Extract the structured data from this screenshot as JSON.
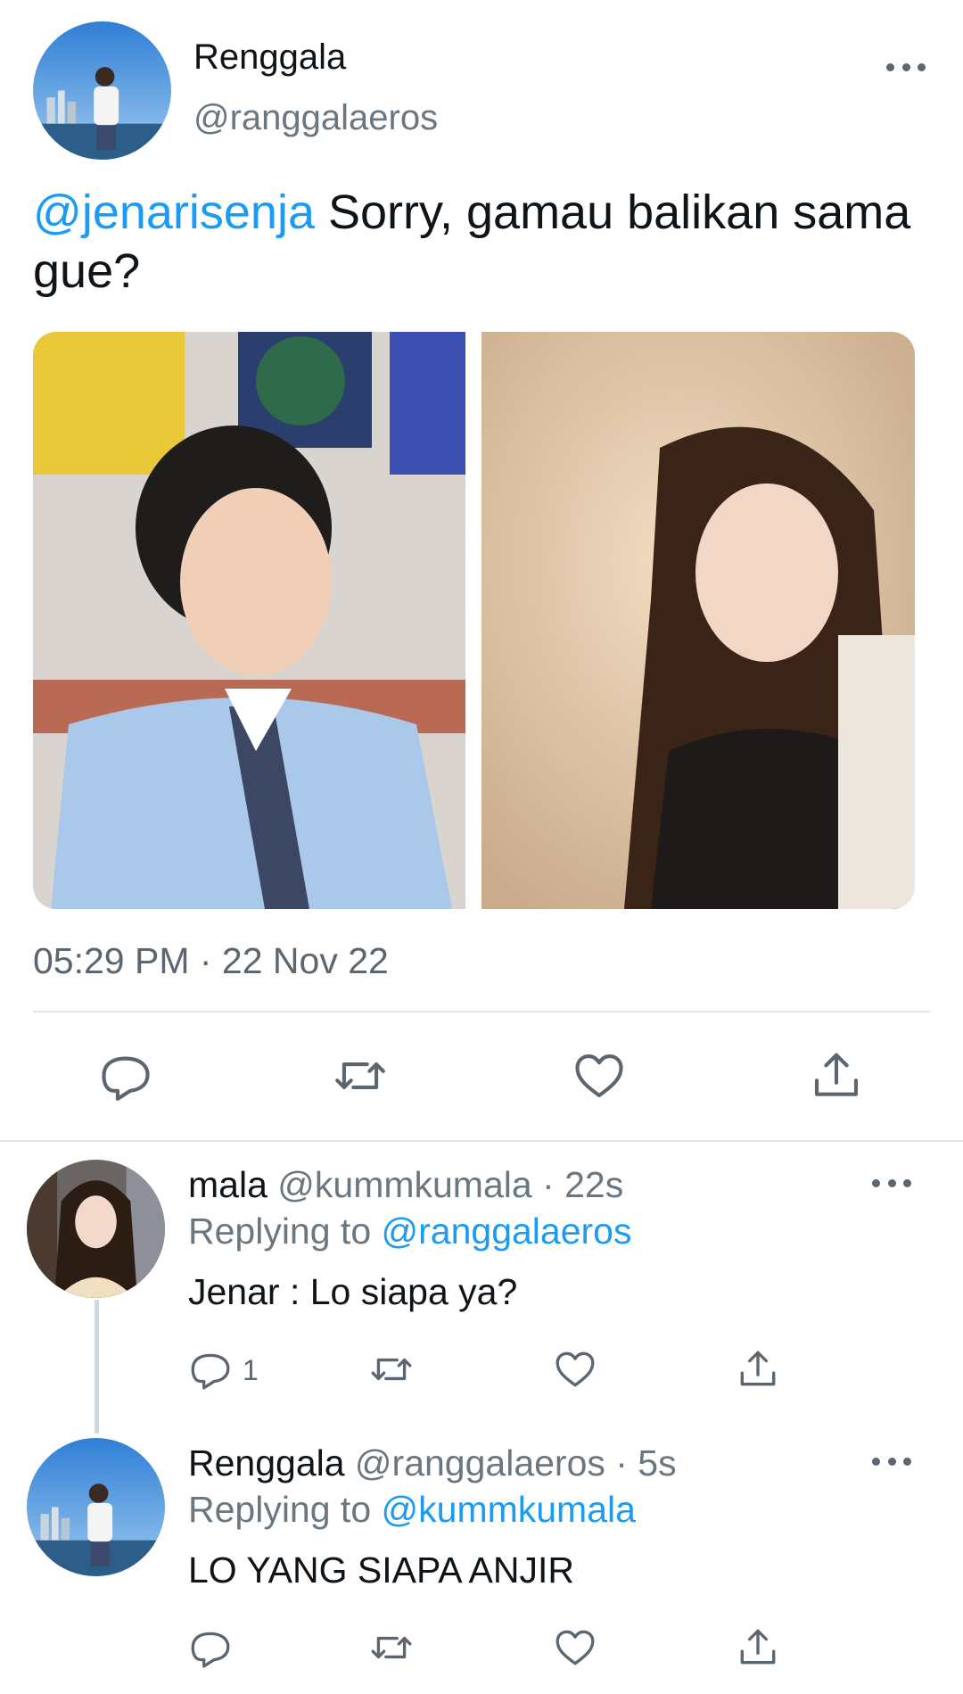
{
  "main_tweet": {
    "author_name": "Renggala",
    "author_handle": "@ranggalaeros",
    "mention": "@jenarisenja",
    "text": " Sorry, gamau balikan sama gue?",
    "timestamp": "05:29 PM · 22 Nov 22",
    "media": [
      "man-photo",
      "woman-photo"
    ]
  },
  "replies": [
    {
      "name": "mala",
      "handle_time": " @kummkumala · 22s",
      "replying_label": "Replying to ",
      "replying_to": "@ranggalaeros",
      "text": "Jenar : Lo siapa ya?",
      "reply_count": "1"
    },
    {
      "name": "Renggala",
      "handle_time": " @ranggalaeros · 5s",
      "replying_label": "Replying to ",
      "replying_to": "@kummkumala",
      "text": "LO YANG SIAPA ANJIR",
      "reply_count": ""
    }
  ],
  "icons": [
    "reply-icon",
    "retweet-icon",
    "like-icon",
    "share-icon",
    "more-icon"
  ],
  "colors": {
    "accent": "#1d9bf0",
    "secondary_text": "#5b6670",
    "divider": "#e1e6ea"
  }
}
